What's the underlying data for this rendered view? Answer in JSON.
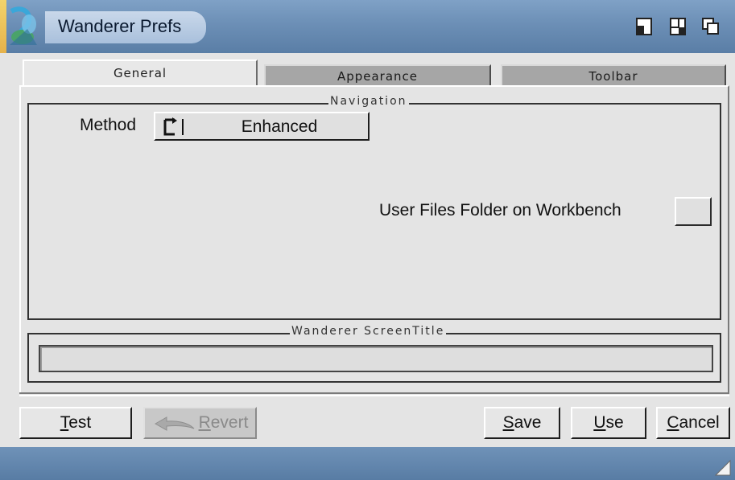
{
  "window": {
    "title": "Wanderer Prefs"
  },
  "tabs": [
    {
      "label": "General",
      "active": true
    },
    {
      "label": "Appearance",
      "active": false
    },
    {
      "label": "Toolbar",
      "active": false
    }
  ],
  "navigation_group": {
    "title": "Navigation",
    "method_label": "Method",
    "method_value": "Enhanced",
    "user_files_label": "User Files Folder on Workbench",
    "user_files_checked": false
  },
  "screentitle_group": {
    "title": "Wanderer ScreenTitle",
    "value": ""
  },
  "buttons": {
    "test": {
      "underline": "T",
      "rest": "est"
    },
    "revert": {
      "underline": "R",
      "rest": "evert",
      "enabled": false
    },
    "save": {
      "underline": "S",
      "rest": "ave"
    },
    "use": {
      "underline": "U",
      "rest": "se"
    },
    "cancel": {
      "underline": "C",
      "rest": "ancel"
    }
  },
  "icons": {
    "app_logo": "wanderer-logo-icon",
    "sys_buttons": [
      "iconify-icon",
      "zoom-icon",
      "depth-icon"
    ],
    "cycle": "cycle-icon",
    "revert": "revert-arrow-icon",
    "resize": "resize-grip-icon"
  },
  "colors": {
    "titlebar": "#6c8fb6",
    "panel_bg": "#e4e4e4",
    "inactive_tab": "#a6a6a6"
  }
}
